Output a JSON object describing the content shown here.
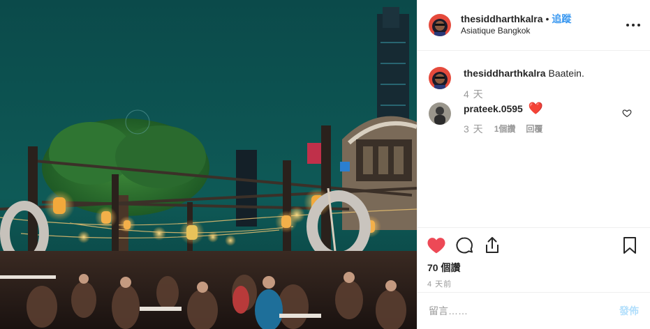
{
  "post": {
    "author": "thesiddharthkalra",
    "separator": "•",
    "follow_label": "追蹤",
    "location": "Asiatique Bangkok",
    "more_icon": "more-horizontal-icon"
  },
  "comments": [
    {
      "user": "thesiddharthkalra",
      "text": "Baatein.",
      "time": "4 天"
    },
    {
      "user": "prateek.0595",
      "text": "❤️",
      "time": "3 天",
      "likes_label": "1個讚",
      "reply_label": "回覆",
      "like_icon": "heart-outline-icon"
    }
  ],
  "actions": {
    "like_icon": "heart-filled-icon",
    "comment_icon": "comment-icon",
    "share_icon": "share-icon",
    "save_icon": "bookmark-icon",
    "likes_count": "70 個讚",
    "posted_ago": "4 天前"
  },
  "composer": {
    "placeholder": "留言……",
    "post_label": "發佈"
  },
  "colors": {
    "accent": "#3897f0",
    "like_red": "#ed4956",
    "muted": "#999999",
    "post_disabled": "#b2dffc"
  }
}
